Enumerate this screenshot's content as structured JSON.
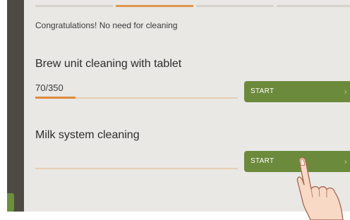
{
  "status": {
    "message": "Congratulations! No need for cleaning"
  },
  "brew_unit": {
    "title": "Brew unit cleaning with tablet",
    "count": "70/350",
    "progress_fraction": 0.2,
    "button_label": "START"
  },
  "milk_system": {
    "title": "Milk system cleaning",
    "progress_fraction": 0.0,
    "button_label": "START"
  },
  "tabs": {
    "count": 4,
    "active_index": 1
  },
  "icons": {
    "chevron": "chevron-right-icon",
    "pointer": "pointing-hand-icon"
  },
  "colors": {
    "accent_orange": "#df8a3c",
    "track_orange": "#e9cdb1",
    "button_green": "#6b8a3b",
    "panel_bg": "#e9e8e5",
    "sidebar_dark": "#4d4a43"
  }
}
